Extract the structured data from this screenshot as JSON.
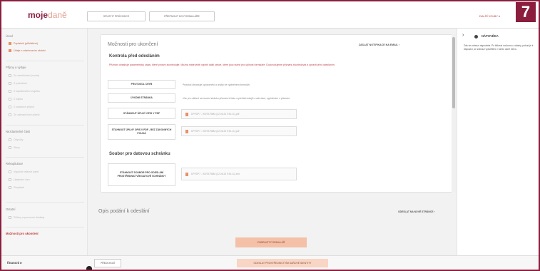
{
  "step_badge": "7",
  "header": {
    "logo_bold": "moje",
    "logo_light": "daně",
    "button_guide": "SPUSTIT PRŮVODCE",
    "button_form": "PŘEPNOUT DO FORMULÁŘE",
    "more_options": "DALŠÍ VOLBY ▾"
  },
  "sidebar": {
    "sections": [
      {
        "label": "Úvod",
        "items": [
          {
            "label": "Poplatník (přihlášení)",
            "checked": true
          },
          {
            "label": "Údaje o zdaňovacím období",
            "checked": true
          }
        ]
      },
      {
        "label": "Příjmy a výdaje",
        "items": [
          {
            "label": "Ze zaměstnání (mzda)",
            "checked": false
          },
          {
            "label": "Z podnikání",
            "checked": false
          },
          {
            "label": "Z kapitálového majetku",
            "checked": false
          },
          {
            "label": "Z nájmu",
            "checked": false
          },
          {
            "label": "Z ostatních příjmů",
            "checked": false
          },
          {
            "label": "Ze zahraničních příjmů",
            "checked": false
          }
        ]
      },
      {
        "label": "Nezdanitelné části",
        "items": [
          {
            "label": "Odpočty",
            "checked": false
          },
          {
            "label": "Slevy",
            "checked": false
          }
        ]
      },
      {
        "label": "Rekapitulace",
        "items": [
          {
            "label": "Výpočet celkové daně",
            "checked": false
          },
          {
            "label": "Uplatnění slev",
            "checked": false
          },
          {
            "label": "Přeplatek",
            "checked": false
          }
        ]
      },
      {
        "label": "Ostatní",
        "items": [
          {
            "label": "Přílohy a pomocné doklady",
            "checked": false
          }
        ]
      }
    ],
    "active_item": "Možnosti pro ukončení"
  },
  "card": {
    "title": "Možnosti pro ukončení",
    "notification_link": "ZASLAT NOTIFIKACE NA EMAIL ›",
    "section_check_title": "Kontrola před odesláním",
    "warning": "Přiznání obsahuje parametrický zápis, které prosím zkontrolujte. Možná máte ještě vyplnit další sekce, které jsou nutné pro úplnost formuláře. Doporučujeme přiznání zkontrolovat a opravit před odesláním.",
    "actions": [
      {
        "label": "PROTOKOL CHYB",
        "desc": "Protokol obsahuje upozornění a chyby ve vyplněném formuláři.",
        "file": ""
      },
      {
        "label": "ÚVODNÍ STRÁNKA",
        "desc": "Vše pro náhled na úvodní stránku přiznání k tisku a přehled údajů o vaší dani, vyplněném v přiznání.",
        "file": ""
      },
      {
        "label": "STÁHNOUT ÚPLNÝ OPIS V PDF",
        "desc": "",
        "file": "DPFDP7 - 9007579884 (22.06.24 9:51:11).pdf"
      },
      {
        "label": "STÁHNOUT ÚPLNÝ OPIS V PDF - BEZ ZÁKONNÝCH POUKÁ",
        "desc": "",
        "file": "DPFDP7 - 9007579884 (22.06.24 9:51:11).pdf"
      }
    ],
    "section_file_title": "Soubor pro datovou schránku",
    "datafile_action": {
      "label": "STÁHNOUT SOUBOR PRO ODESLÁNÍ PROSTŘEDNICTVÍM DATOVÉ SCHRÁNKY",
      "file": "DPFDP7 - 9007579884 (22.06.24 9:51:11).xml"
    }
  },
  "section2": {
    "title": "Opis podání k odeslání",
    "next_link": "ODESLAT NA NOVÉ STRÁNCE ›",
    "submit_button": "ZOBRAZIT FORMULÁŘ"
  },
  "help": {
    "title": "NÁPOVĚDA",
    "text": "Zde se zobrazí nápověda. Po kliknutí na ikonu u otázky, pokud je k dispozici, se zobrazí vysvětlení v tomto okně vlevo."
  },
  "footer": {
    "logo": "financni ▸",
    "prev_button": "PŘEDCHOZÍ",
    "save_button": "ODESLAT PROSTŘEDNICTVÍM DAŇOVÉ IDENTITY"
  }
}
